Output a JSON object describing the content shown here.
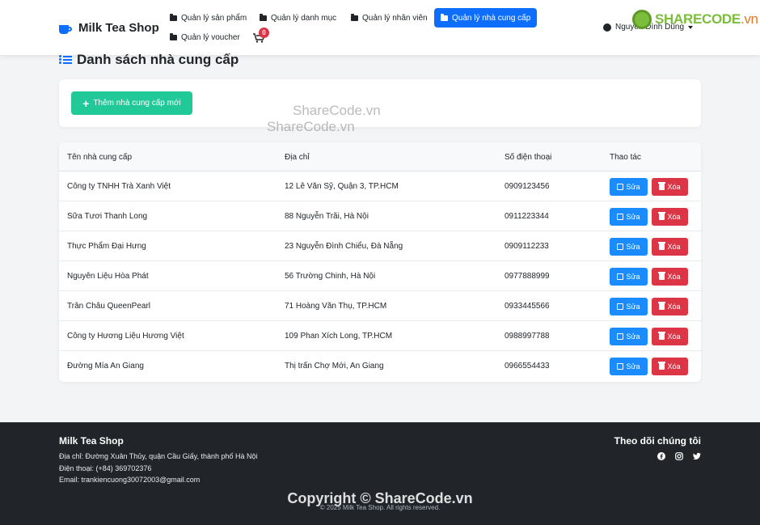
{
  "navbar": {
    "brand": "Milk Tea Shop",
    "items": [
      {
        "label": "Quản lý sản phẩm"
      },
      {
        "label": "Quản lý danh mục"
      },
      {
        "label": "Quản lý nhân viên"
      },
      {
        "label": "Quản lý nhà cung cấp"
      },
      {
        "label": "Quản lý voucher"
      }
    ],
    "active_item": "Quản lý nhà cung cấp",
    "cart_count": "0",
    "user_name": "Nguyễn Đình Dũng"
  },
  "watermark_logo": {
    "main": "SHARECODE",
    "suffix": ".vn"
  },
  "page": {
    "title": "Danh sách nhà cung cấp",
    "add_button": "Thêm nhà cung cấp mới"
  },
  "table": {
    "headers": [
      "Tên nhà cung cấp",
      "Địa chỉ",
      "Số điện thoại",
      "Thao tác"
    ],
    "rows": [
      {
        "name": "Công ty TNHH Trà Xanh Việt",
        "address": "12 Lê Văn Sỹ, Quận 3, TP.HCM",
        "phone": "0909123456"
      },
      {
        "name": "Sữa Tươi Thanh Long",
        "address": "88 Nguyễn Trãi, Hà Nội",
        "phone": "0911223344"
      },
      {
        "name": "Thực Phẩm Đại Hưng",
        "address": "23 Nguyễn Đình Chiểu, Đà Nẵng",
        "phone": "0909112233"
      },
      {
        "name": "Nguyên Liệu Hòa Phát",
        "address": "56 Trường Chinh, Hà Nội",
        "phone": "0977888999"
      },
      {
        "name": "Trân Châu QueenPearl",
        "address": "71 Hoàng Văn Thụ, TP.HCM",
        "phone": "0933445566"
      },
      {
        "name": "Công ty Hương Liệu Hương Việt",
        "address": "109 Phan Xích Long, TP.HCM",
        "phone": "0988997788"
      },
      {
        "name": "Đường Mía An Giang",
        "address": "Thị trấn Chợ Mới, An Giang",
        "phone": "0966554433"
      }
    ],
    "edit_label": "Sửa",
    "delete_label": "Xóa"
  },
  "watermarks": [
    "ShareCode.vn",
    "ShareCode.vn",
    "Copyright © ShareCode.vn"
  ],
  "footer": {
    "title": "Milk Tea Shop",
    "address": "Địa chỉ: Đường Xuân Thủy, quận Cầu Giấy, thành phố Hà Nội",
    "phone": "Điện thoại: (+84) 369702376",
    "email": "Email: trankiencuong30072003@gmail.com",
    "follow_title": "Theo dõi chúng tôi",
    "socials": [
      "facebook-icon",
      "instagram-icon",
      "twitter-icon"
    ],
    "copyright": "© 2025 Milk Tea Shop. All rights reserved."
  },
  "colors": {
    "primary": "#0d6efd",
    "success": "#20c997",
    "danger": "#dc3545",
    "footer_bg": "#212529"
  }
}
